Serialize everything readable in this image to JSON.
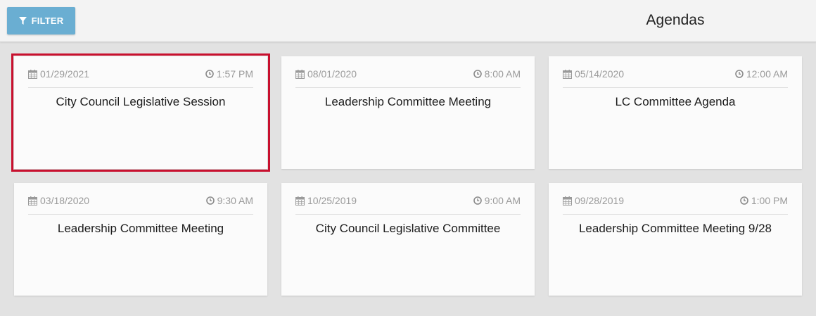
{
  "header": {
    "filter_label": "FILTER",
    "title": "Agendas"
  },
  "colors": {
    "filter_button": "#6aaed2",
    "selected_outline": "#c8102e",
    "meta_text": "#9a9a9a"
  },
  "cards": [
    {
      "date": "01/29/2021",
      "time": "1:57 PM",
      "title": "City Council Legislative Session",
      "selected": true
    },
    {
      "date": "08/01/2020",
      "time": "8:00 AM",
      "title": "Leadership Committee Meeting",
      "selected": false
    },
    {
      "date": "05/14/2020",
      "time": "12:00 AM",
      "title": "LC Committee Agenda",
      "selected": false
    },
    {
      "date": "03/18/2020",
      "time": "9:30 AM",
      "title": "Leadership Committee Meeting",
      "selected": false
    },
    {
      "date": "10/25/2019",
      "time": "9:00 AM",
      "title": "City Council Legislative Committee",
      "selected": false
    },
    {
      "date": "09/28/2019",
      "time": "1:00 PM",
      "title": "Leadership Committee Meeting 9/28",
      "selected": false
    }
  ]
}
